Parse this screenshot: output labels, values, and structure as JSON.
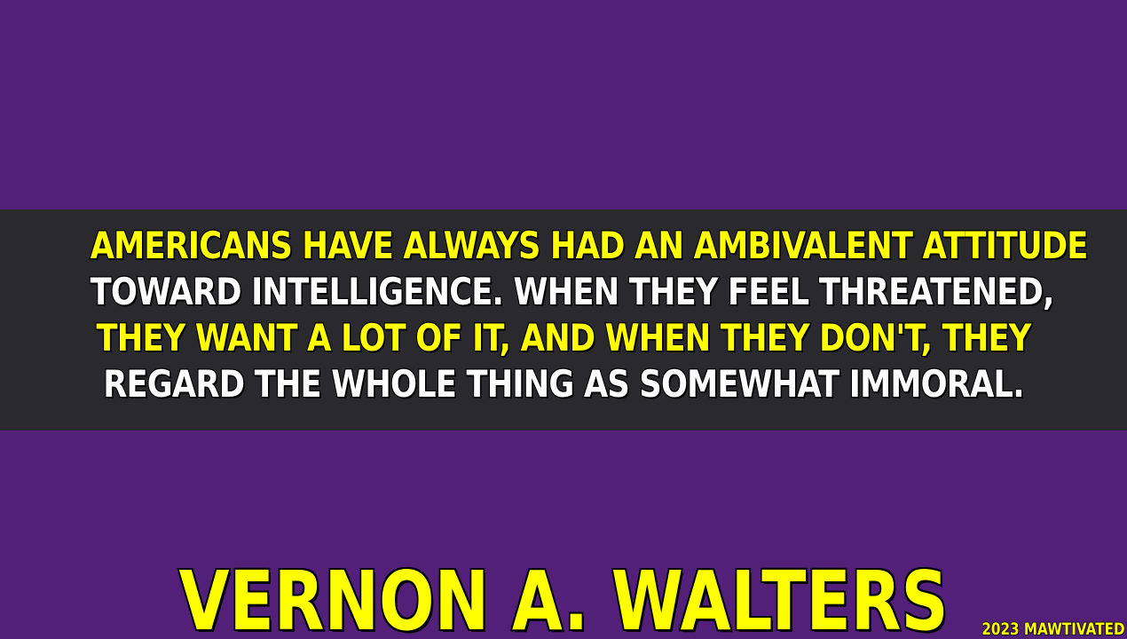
{
  "quote": {
    "lines": [
      "AMERICANS HAVE ALWAYS HAD AN AMBIVALENT ATTITUDE",
      "TOWARD INTELLIGENCE. WHEN THEY FEEL THREATENED,",
      "THEY WANT A LOT OF IT, AND WHEN THEY DON'T, THEY",
      "REGARD THE WHOLE THING AS SOMEWHAT IMMORAL."
    ]
  },
  "author": "VERNON A. WALTERS",
  "credit": "2023 MAWTIVATED",
  "colors": {
    "background": "#521f79",
    "band": "#2a2a2e",
    "accent_text": "#ffff00",
    "secondary_text": "#ffffff",
    "outline": "#000000"
  }
}
